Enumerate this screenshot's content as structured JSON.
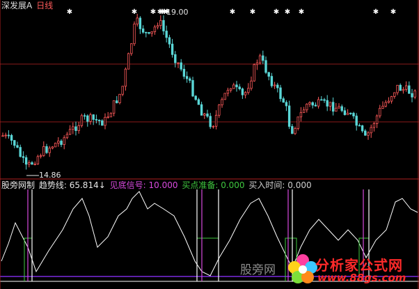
{
  "header": {
    "stock_name": "深发展A",
    "period": "日线"
  },
  "price_panel": {
    "high_label": "19.00",
    "low_label": "14.86"
  },
  "indicator": {
    "name": "股旁网制",
    "trend_label": "趋势线:",
    "trend_value": "65.814",
    "trend_arrow": "↓",
    "bottom_signal_label": "见底信号:",
    "bottom_signal_value": "10.000",
    "buy_prep_label": "买点准备:",
    "buy_prep_value": "0.000",
    "buy_time_label": "买入时间:",
    "buy_time_value": "0.000"
  },
  "watermark": {
    "text": "股旁网",
    "brand": "分析家公式网",
    "url": "www.88gs.com"
  },
  "colors": {
    "up_candle": "#ff5a5a",
    "down_candle": "#5ad7d7",
    "trend_line": "#ffffff",
    "signal_line": "#d94adf",
    "prep_line": "#3fc83f",
    "grid_line": "#8b1a1a"
  }
}
